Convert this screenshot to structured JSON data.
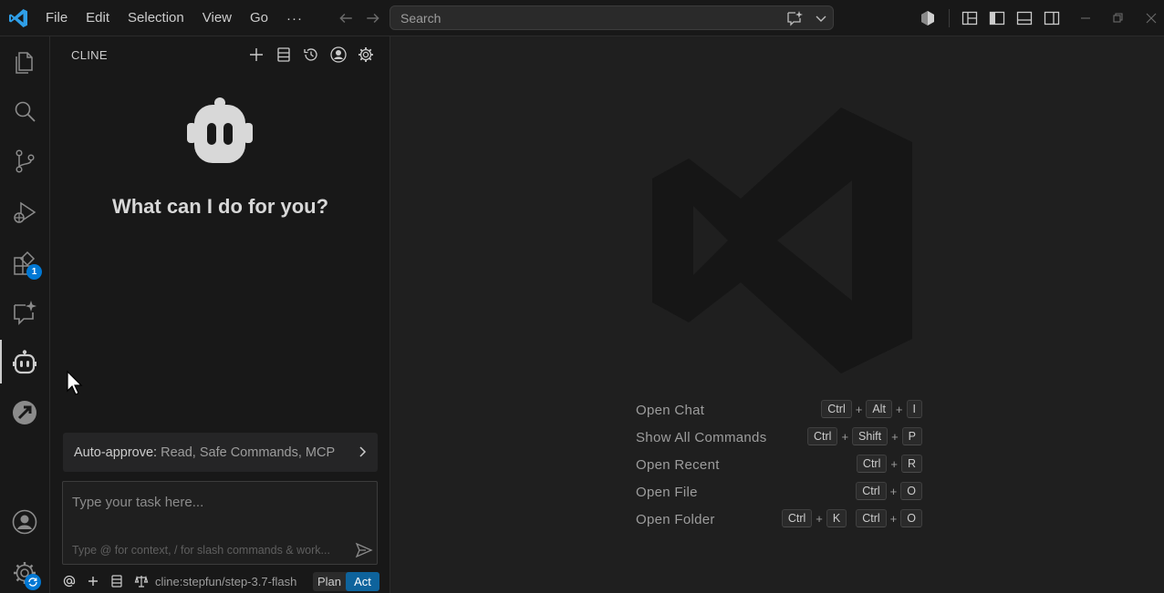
{
  "titlebar": {
    "menu": [
      "File",
      "Edit",
      "Selection",
      "View",
      "Go"
    ],
    "more": "···",
    "search_placeholder": "Search"
  },
  "activitybar": {
    "items": [
      "explorer-icon",
      "search-icon",
      "source-control-icon",
      "run-debug-icon",
      "extensions-icon",
      "chat-sparkle-icon",
      "cline-robot-icon",
      "remote-explorer-icon"
    ],
    "extensions_badge": "1",
    "bottom": [
      "accounts-icon",
      "manage-gear-icon"
    ]
  },
  "sidepanel": {
    "title": "CLINE",
    "welcome": "What can I do for you?",
    "auto_approve_label": "Auto-approve:",
    "auto_approve_items": "Read, Safe Commands, MCP",
    "task_placeholder": "Type your task here...",
    "task_hint": "Type @ for context, / for slash commands & work...",
    "model": "cline:stepfun/step-3.7-flash",
    "mode_plan": "Plan",
    "mode_act": "Act"
  },
  "editor": {
    "shortcuts": [
      {
        "label": "Open Chat",
        "keys": [
          [
            "Ctrl",
            "Alt",
            "I"
          ]
        ]
      },
      {
        "label": "Show All Commands",
        "keys": [
          [
            "Ctrl",
            "Shift",
            "P"
          ]
        ]
      },
      {
        "label": "Open Recent",
        "keys": [
          [
            "Ctrl",
            "R"
          ]
        ]
      },
      {
        "label": "Open File",
        "keys": [
          [
            "Ctrl",
            "O"
          ]
        ]
      },
      {
        "label": "Open Folder",
        "keys": [
          [
            "Ctrl",
            "K"
          ],
          [
            "Ctrl",
            "O"
          ]
        ]
      }
    ]
  },
  "colors": {
    "accent": "#0078d4",
    "act_button": "#0e639c",
    "background": "#1f1f1f",
    "chrome": "#181818"
  }
}
